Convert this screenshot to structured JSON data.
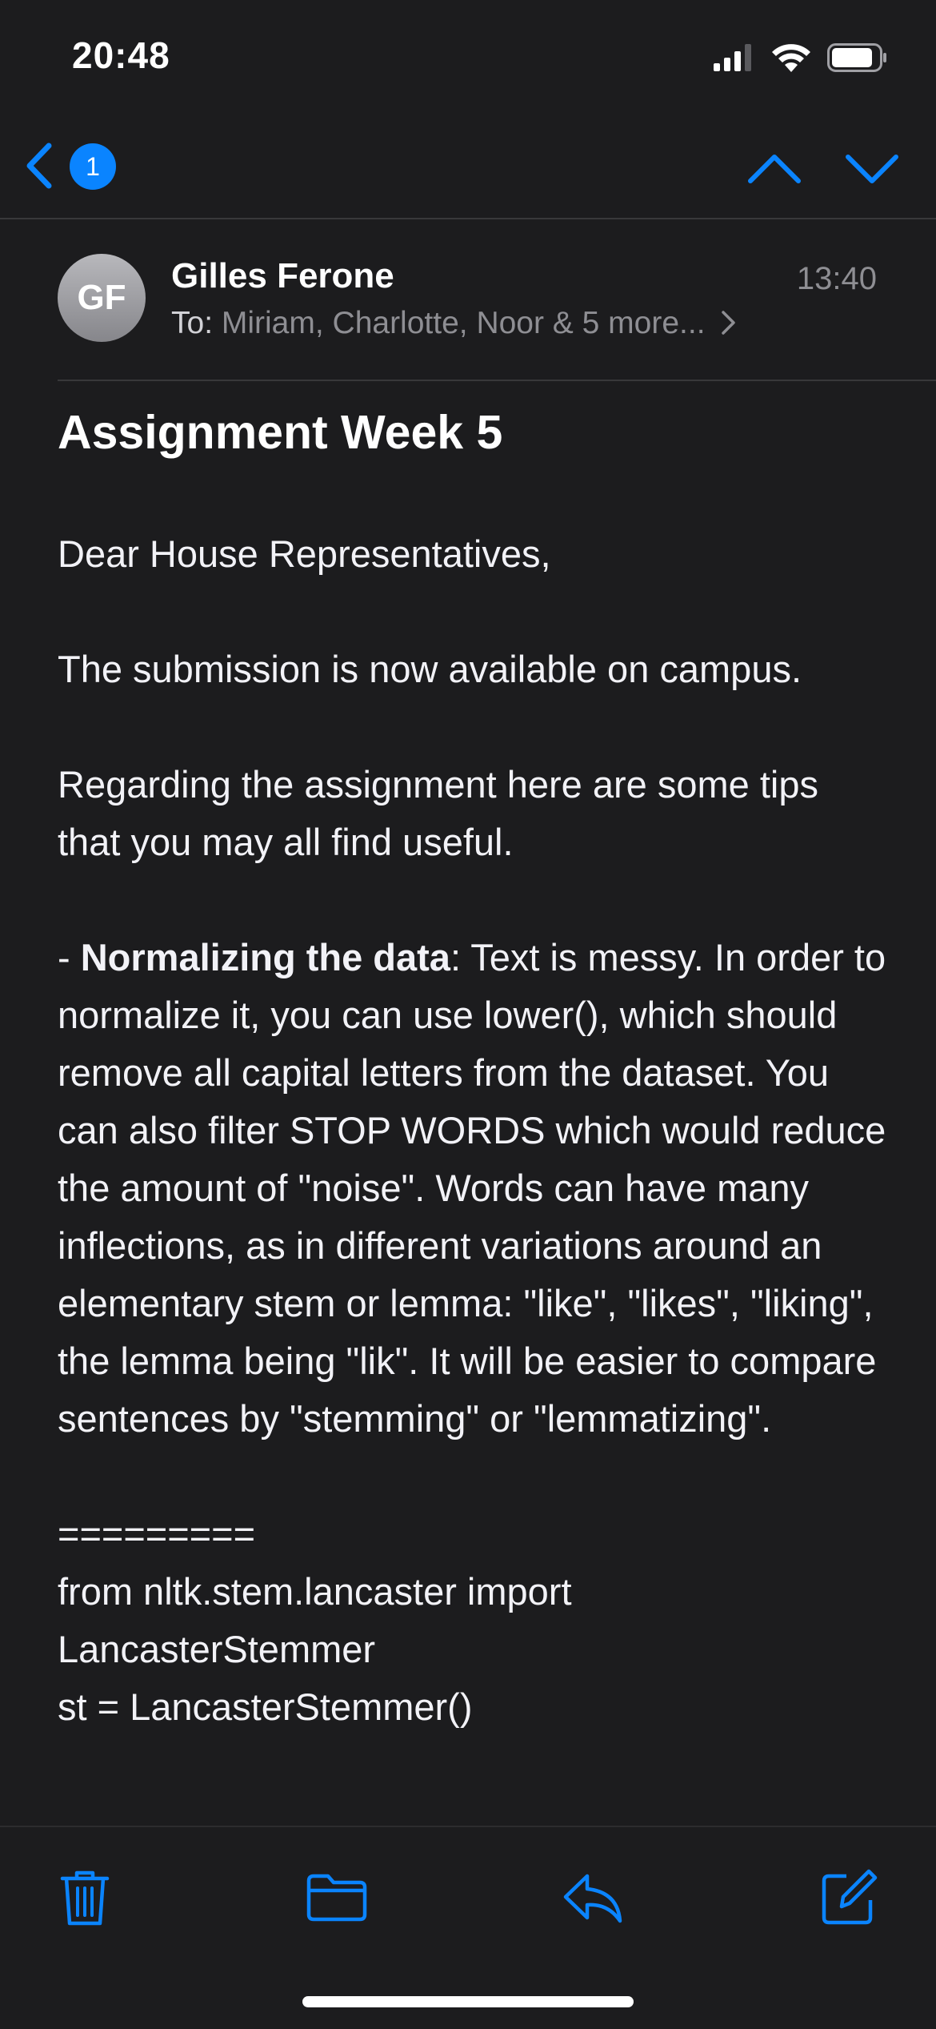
{
  "status_bar": {
    "time": "20:48"
  },
  "nav": {
    "unread_count": "1"
  },
  "message": {
    "sender_initials": "GF",
    "sender_name": "Gilles Ferone",
    "time": "13:40",
    "to_label": "To:",
    "recipients": "Miriam, Charlotte, Noor & 5 more...",
    "subject": "Assignment Week 5",
    "body": {
      "greeting": "Dear House Representatives,",
      "line1": "The submission is now available on campus.",
      "line2": "Regarding the assignment here are some tips that you may all find useful.",
      "tip_prefix": "- ",
      "tip_title": "Normalizing the data",
      "tip_body": ": Text is messy. In order to normalize it, you can use lower(), which should remove all capital letters from the dataset. You can also filter STOP WORDS which would reduce the amount of \"noise\". Words can have many inflections, as in different variations around an elementary stem or lemma:  \"like\", \"likes\", \"liking\", the lemma being \"lik\". It will be easier to compare sentences by \"stemming\" or \"lemmatizing\".",
      "separator": "=========",
      "code1": "from nltk.stem.lancaster import LancasterStemmer",
      "code2": "st = LancasterStemmer()"
    }
  },
  "toolbar": {
    "icons": [
      "trash-icon",
      "folder-icon",
      "reply-icon",
      "compose-icon"
    ]
  },
  "colors": {
    "accent": "#0a84ff",
    "background": "#1c1c1e",
    "secondary_text": "#8e8e93"
  }
}
